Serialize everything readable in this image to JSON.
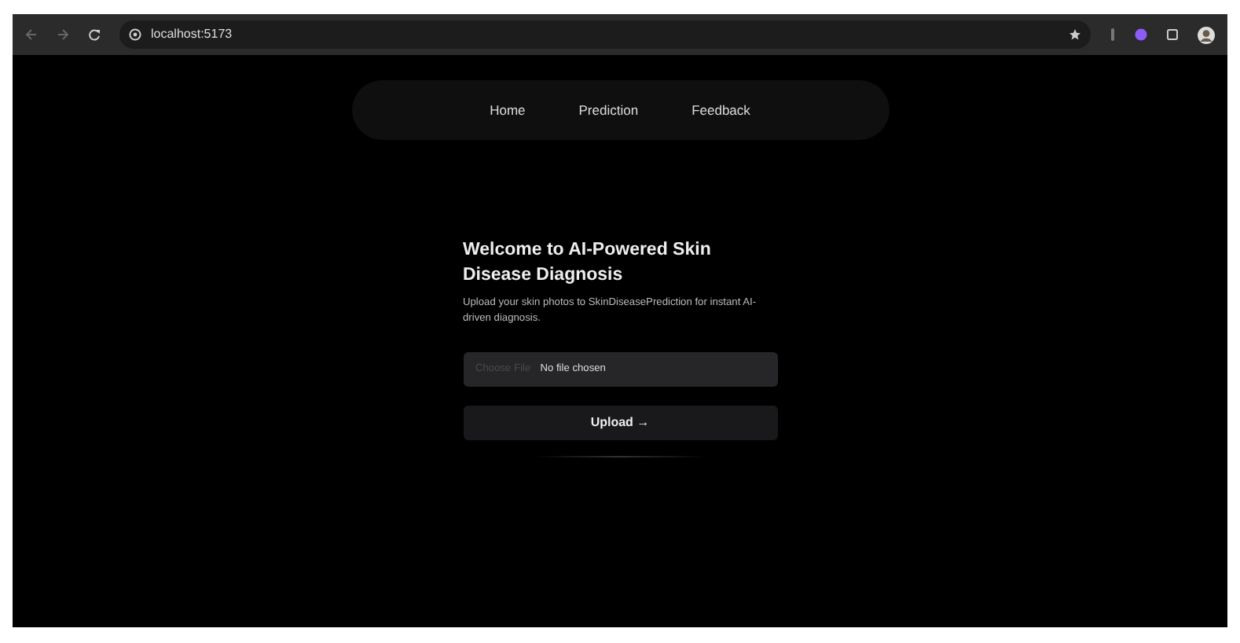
{
  "browser": {
    "url": "localhost:5173"
  },
  "nav": [
    {
      "label": "Home"
    },
    {
      "label": "Prediction"
    },
    {
      "label": "Feedback"
    }
  ],
  "heading": "Welcome to AI-Powered Skin Disease Diagnosis",
  "description": "Upload your skin photos to SkinDiseasePrediction for instant AI-driven diagnosis.",
  "file_input": {
    "button": "Choose File",
    "status": "No file chosen"
  },
  "upload_button": "Upload →"
}
